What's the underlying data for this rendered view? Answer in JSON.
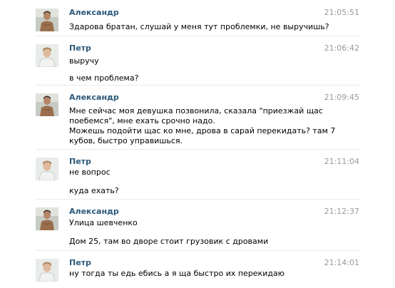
{
  "users": {
    "alexander": {
      "name": "Александр"
    },
    "petr": {
      "name": "Петр"
    }
  },
  "messages": [
    {
      "author": "Александр",
      "time": "21:05:51",
      "lines": [
        "Здарова братан, слушай у меня тут проблемки, не выручишь?"
      ]
    },
    {
      "author": "Петр",
      "time": "21:06:42",
      "lines": [
        "выручу",
        "в чем проблема?"
      ]
    },
    {
      "author": "Александр",
      "time": "21:09:45",
      "lines": [
        "Мне сейчас моя девушка позвонила, сказала \"приезжай щас",
        "поебемся\", мне ехать срочно надо.",
        "Можешь подойти щас ко мне, дрова в сарай перекидать? там 7",
        "кубов, быстро управишься."
      ]
    },
    {
      "author": "Петр",
      "time": "21:11:04",
      "lines": [
        "не вопрос",
        "куда ехать?"
      ]
    },
    {
      "author": "Александр",
      "time": "21:12:37",
      "lines": [
        "Улица шевченко",
        "Дом 25, там во дворе стоит грузовик с дровами"
      ]
    },
    {
      "author": "Петр",
      "time": "21:14:01",
      "lines": [
        "ну тогда ты едь ебись а я ща быстро их перекидаю"
      ]
    }
  ]
}
